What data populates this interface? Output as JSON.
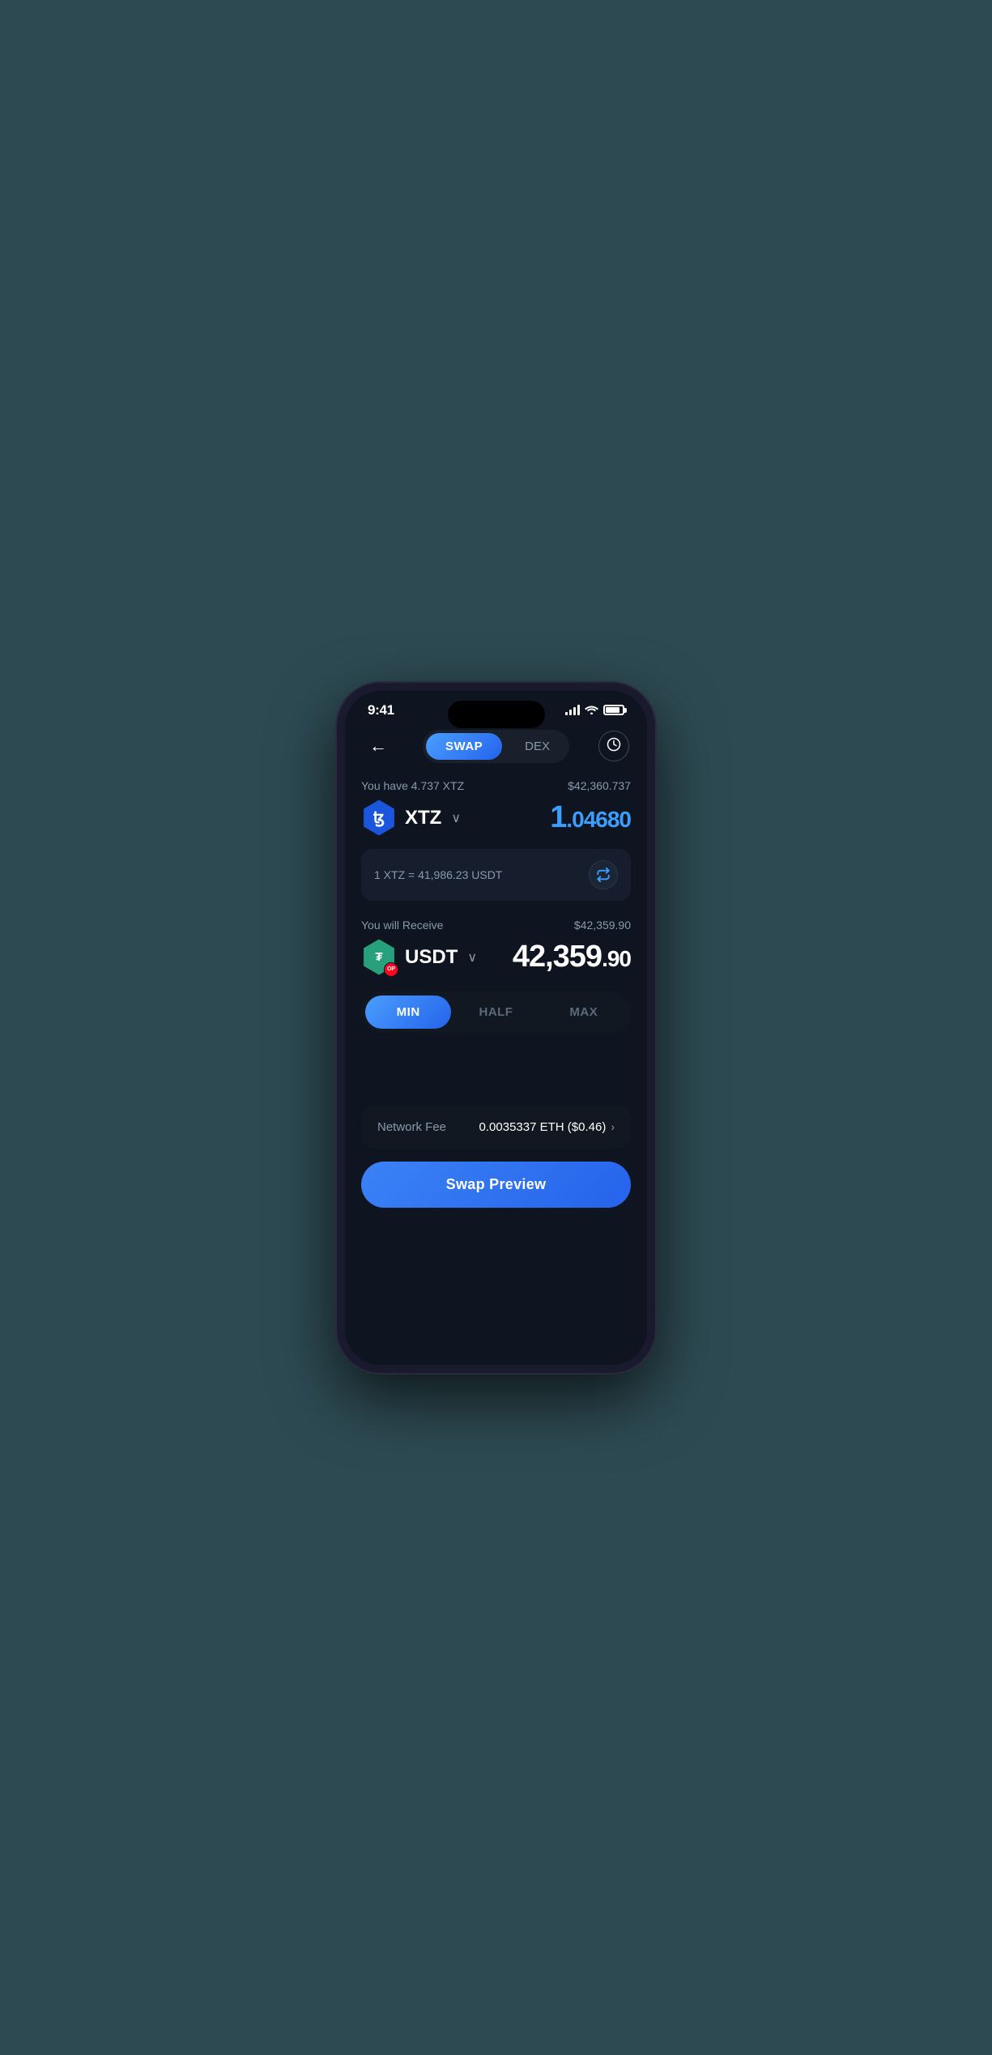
{
  "statusBar": {
    "time": "9:41",
    "batteryLevel": 85
  },
  "header": {
    "backLabel": "←",
    "tabSwap": "SWAP",
    "tabDex": "DEX",
    "historyIcon": "🕐"
  },
  "fromToken": {
    "balanceLabel": "You have 4.737 XTZ",
    "balanceUsd": "$42,360.737",
    "tokenSymbol": "XTZ",
    "tokenIcon": "ꜩ",
    "amountWhole": "1",
    "amountDecimal": ".04680"
  },
  "exchangeRate": {
    "text": "1 XTZ = 41,986.23 USDT",
    "swapIcon": "⇅"
  },
  "toToken": {
    "receiveLabel": "You will Receive",
    "receiveUsd": "$42,359.90",
    "tokenSymbol": "USDT",
    "tokenIcon": "₮",
    "opBadge": "OP",
    "amountWhole": "42,359",
    "amountDecimal": ".90"
  },
  "amountButtons": {
    "min": "MIN",
    "half": "HALF",
    "max": "MAX",
    "activeButton": "min"
  },
  "networkFee": {
    "label": "Network Fee",
    "value": "0.0035337 ETH ($0.46)",
    "chevron": "›"
  },
  "swapPreview": {
    "label": "Swap Preview"
  }
}
